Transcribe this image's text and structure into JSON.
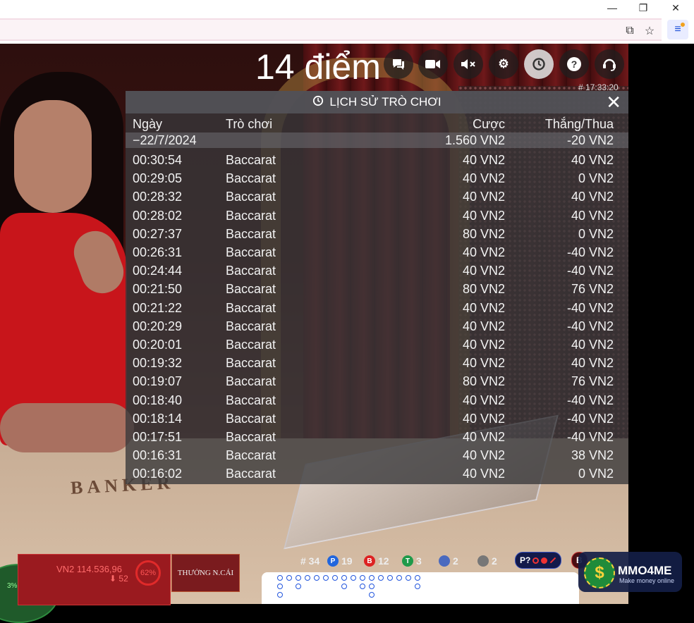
{
  "browser": {
    "window_controls": {
      "minimize": "—",
      "restore": "❐",
      "close": "✕"
    }
  },
  "overlay": {
    "score_text": "14 điểm",
    "round_id": "# 17:33:20"
  },
  "history": {
    "title": "LỊCH SỬ TRÒ CHƠI",
    "columns": {
      "date": "Ngày",
      "game": "Trò chơi",
      "bet": "Cược",
      "win_loss": "Thắng/Thua"
    },
    "summary": {
      "date": "−22/7/2024",
      "bet": "1.560 VN2",
      "win_loss": "-20 VN2"
    },
    "rows": [
      {
        "time": "00:30:54",
        "game": "Baccarat",
        "bet": "40 VN2",
        "result": "40 VN2"
      },
      {
        "time": "00:29:05",
        "game": "Baccarat",
        "bet": "40 VN2",
        "result": "0 VN2"
      },
      {
        "time": "00:28:32",
        "game": "Baccarat",
        "bet": "40 VN2",
        "result": "40 VN2"
      },
      {
        "time": "00:28:02",
        "game": "Baccarat",
        "bet": "40 VN2",
        "result": "40 VN2"
      },
      {
        "time": "00:27:37",
        "game": "Baccarat",
        "bet": "80 VN2",
        "result": "0 VN2"
      },
      {
        "time": "00:26:31",
        "game": "Baccarat",
        "bet": "40 VN2",
        "result": "-40 VN2"
      },
      {
        "time": "00:24:44",
        "game": "Baccarat",
        "bet": "40 VN2",
        "result": "-40 VN2"
      },
      {
        "time": "00:21:50",
        "game": "Baccarat",
        "bet": "80 VN2",
        "result": "76 VN2"
      },
      {
        "time": "00:21:22",
        "game": "Baccarat",
        "bet": "40 VN2",
        "result": "-40 VN2"
      },
      {
        "time": "00:20:29",
        "game": "Baccarat",
        "bet": "40 VN2",
        "result": "-40 VN2"
      },
      {
        "time": "00:20:01",
        "game": "Baccarat",
        "bet": "40 VN2",
        "result": "40 VN2"
      },
      {
        "time": "00:19:32",
        "game": "Baccarat",
        "bet": "40 VN2",
        "result": "40 VN2"
      },
      {
        "time": "00:19:07",
        "game": "Baccarat",
        "bet": "80 VN2",
        "result": "76 VN2"
      },
      {
        "time": "00:18:40",
        "game": "Baccarat",
        "bet": "40 VN2",
        "result": "-40 VN2"
      },
      {
        "time": "00:18:14",
        "game": "Baccarat",
        "bet": "40 VN2",
        "result": "-40 VN2"
      },
      {
        "time": "00:17:51",
        "game": "Baccarat",
        "bet": "40 VN2",
        "result": "-40 VN2"
      },
      {
        "time": "00:16:31",
        "game": "Baccarat",
        "bet": "40 VN2",
        "result": "38 VN2"
      },
      {
        "time": "00:16:02",
        "game": "Baccarat",
        "bet": "40 VN2",
        "result": "0 VN2"
      }
    ]
  },
  "table": {
    "felt_label": "BANKER",
    "balance": "VN2 114.536,96",
    "balance_sub": "⬇ 52",
    "banker_pct": "62%",
    "banker_button": "THƯỞNG N.CÁI",
    "left_pct": "3%",
    "stats": {
      "round": "# 34",
      "player_badge": "P",
      "player_count": "19",
      "banker_badge": "B",
      "banker_count": "12",
      "tie_badge": "T",
      "tie_count": "3",
      "player_pair_count": "2",
      "banker_pair_count": "2"
    },
    "predict_player": "P?",
    "predict_banker": "B"
  },
  "watermark": {
    "title": "MMO4ME",
    "subtitle": "Make money online",
    "symbol": "$"
  },
  "colors": {
    "player_blue": "#2266dd",
    "banker_red": "#dd2222",
    "tie_green": "#1f9a4a",
    "panel_bg": "#37373a"
  }
}
